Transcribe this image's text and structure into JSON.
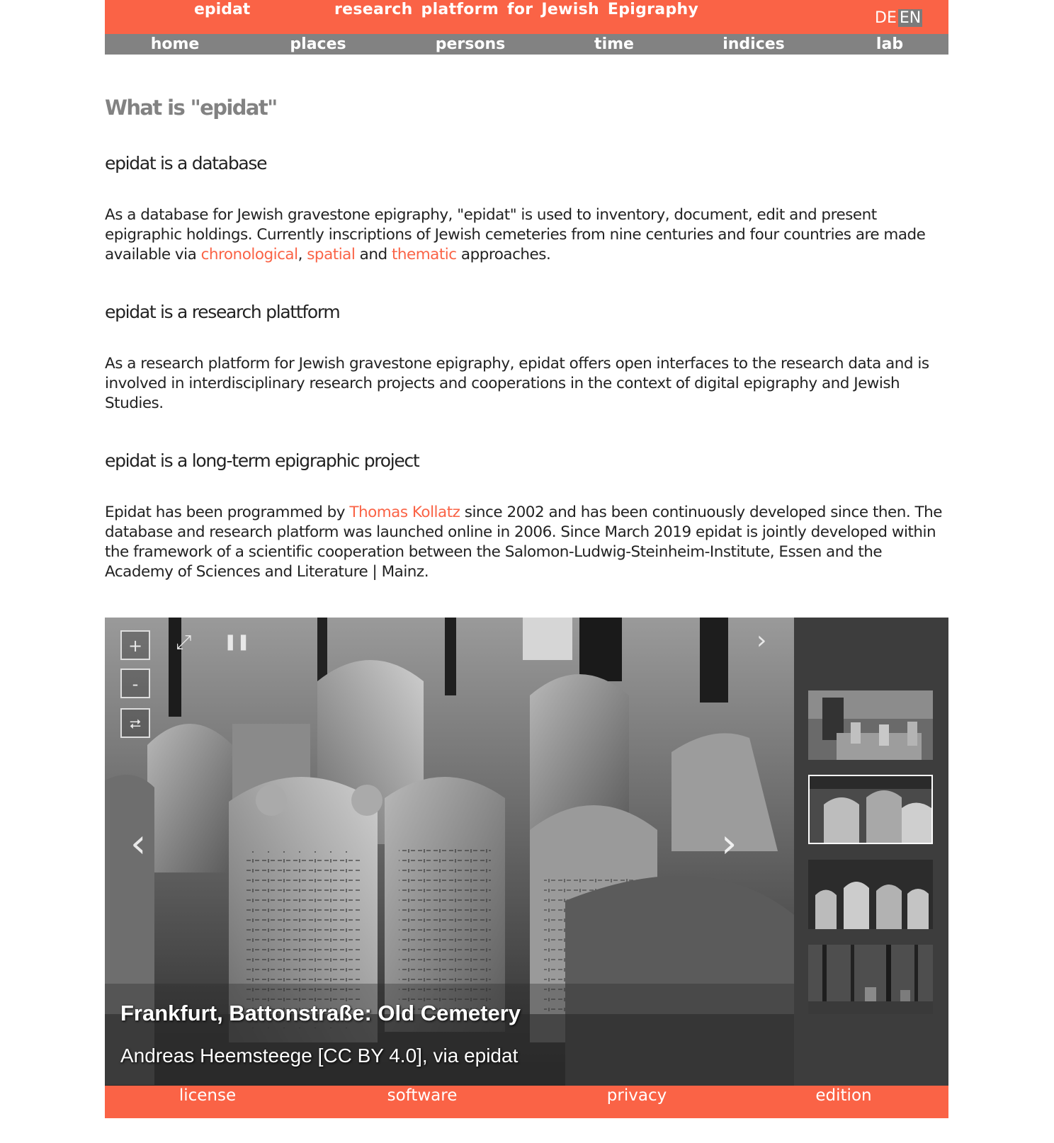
{
  "header": {
    "brand": "epidat",
    "tagline": "research platform for Jewish Epigraphy",
    "lang": {
      "de": "DE",
      "en": "EN",
      "active": "EN"
    }
  },
  "nav": [
    "home",
    "places",
    "persons",
    "time",
    "indices",
    "lab"
  ],
  "main": {
    "title": "What is \"epidat\"",
    "sections": [
      {
        "heading": "epidat is a database",
        "p": {
          "t1": "As a database for Jewish gravestone epigraphy, \"epidat\" is used to inventory, document, edit and present epigraphic holdings. Currently inscriptions of Jewish cemeteries from nine centuries and four countries are made available via ",
          "l1": "chronological",
          "t2": ", ",
          "l2": "spatial",
          "t3": " and ",
          "l3": "thematic",
          "t4": " approaches."
        }
      },
      {
        "heading": "epidat is a research plattform",
        "p": "As a research platform for Jewish gravestone epigraphy, epidat offers open interfaces to the research data and is involved in interdisciplinary research projects and cooperations in the context of digital epigraphy and Jewish Studies."
      },
      {
        "heading": "epidat is a long-term epigraphic project",
        "p": {
          "t1": "Epidat has been programmed by ",
          "l1": "Thomas Kollatz",
          "t2": " since 2002 and has been continuously developed since then. The database and research platform was launched online in 2006. Since March 2019 epidat is jointly developed within the framework of a scientific cooperation between the Salomon-Ludwig-Steinheim-Institute, Essen and the Academy of Sciences and Literature | Mainz."
        }
      }
    ]
  },
  "slideshow": {
    "caption_title": "Frankfurt, Battonstraße: Old Cemetery",
    "caption_credit": "Andreas Heemsteege [CC BY 4.0], via epidat",
    "thumbnail_count": 4,
    "selected_thumbnail": 2,
    "controls": {
      "zoom_in": "+",
      "zoom_out": "-",
      "rotate": "⮂",
      "fullscreen": "⤢",
      "pause": "❚❚",
      "next_top": "›",
      "prev": "‹",
      "next": "›"
    }
  },
  "footer": [
    "license",
    "software",
    "privacy",
    "edition"
  ],
  "colors": {
    "accent": "#fa6346",
    "nav_bg": "#828282",
    "lang_active_bg": "#7b7b7b",
    "thumbs_bg": "#3d3d3d"
  }
}
